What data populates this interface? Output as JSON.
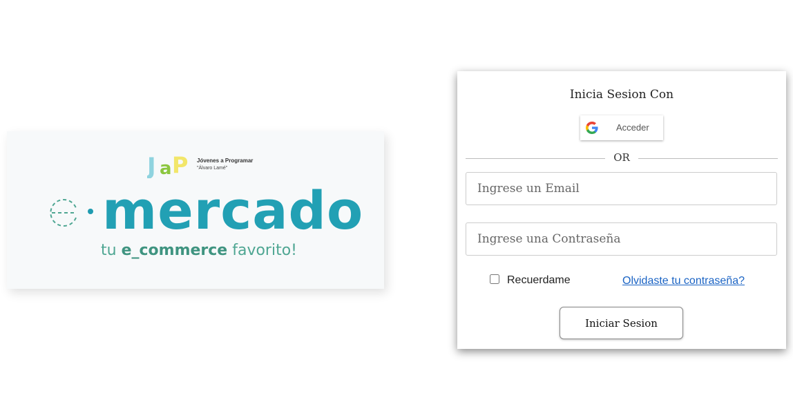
{
  "brand": {
    "jap_org_line1": "Jóvenes a Programar",
    "jap_org_line2": "\"Álvaro Lamé\"",
    "logo_word": "mercado",
    "tagline_prefix": "tu ",
    "tagline_bold": "e_commerce",
    "tagline_suffix": " favorito!",
    "colors": {
      "primary": "#22a0b4",
      "secondary": "#4ea692"
    }
  },
  "login": {
    "title": "Inicia Sesion Con",
    "google_button_label": "Acceder",
    "separator_text": "OR",
    "email_placeholder": "Ingrese un Email",
    "password_placeholder": "Ingrese una Contraseña",
    "remember_label": "Recuerdame",
    "remember_checked": false,
    "forgot_link": "Olvidaste tu contraseña?",
    "submit_label": "Iniciar Sesion"
  },
  "icons": {
    "google": "google-g-icon",
    "e_symbol": "e-logo-icon"
  }
}
